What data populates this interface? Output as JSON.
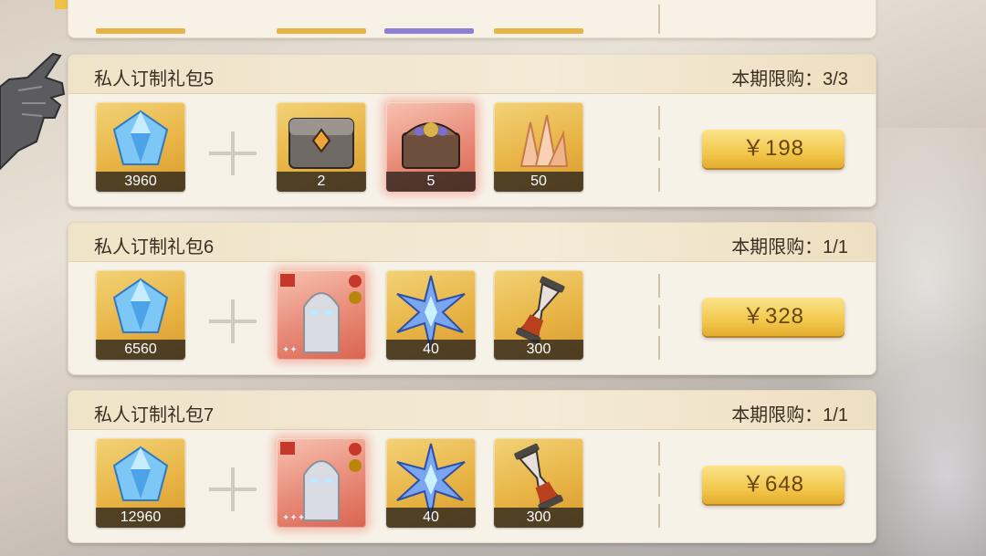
{
  "colors": {
    "gold_slot": "#e8b445",
    "red_slot": "#e88a78",
    "price_button": "#f2c84c",
    "text_dark": "#3a2e22"
  },
  "packs": [
    {
      "name": "私人订制礼包5",
      "limit": "本期限购：3/3",
      "price": "￥198",
      "items": [
        {
          "icon": "blue-diamond-icon",
          "count": "3960"
        },
        {
          "icon": "metal-chest-icon",
          "count": "2"
        },
        {
          "icon": "treasure-box-icon",
          "count": "5"
        },
        {
          "icon": "orange-crystal-icon",
          "count": "50"
        }
      ]
    },
    {
      "name": "私人订制礼包6",
      "limit": "本期限购：1/1",
      "price": "￥328",
      "items": [
        {
          "icon": "blue-diamond-icon",
          "count": "6560"
        },
        {
          "icon": "hero-portrait-icon",
          "count": ""
        },
        {
          "icon": "blue-star-crystal-icon",
          "count": "40"
        },
        {
          "icon": "hourglass-icon",
          "count": "300"
        }
      ]
    },
    {
      "name": "私人订制礼包7",
      "limit": "本期限购：1/1",
      "price": "￥648",
      "items": [
        {
          "icon": "blue-diamond-icon",
          "count": "12960"
        },
        {
          "icon": "hero-portrait-icon",
          "count": ""
        },
        {
          "icon": "blue-star-crystal-icon",
          "count": "40"
        },
        {
          "icon": "hourglass-icon",
          "count": "300"
        }
      ]
    }
  ]
}
